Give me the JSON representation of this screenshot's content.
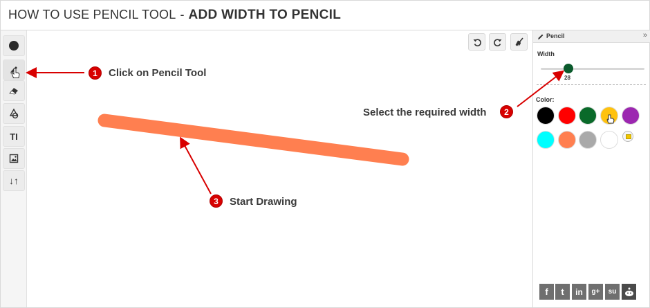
{
  "header": {
    "subtitle": "HOW TO USE PENCIL TOOL",
    "separator": "-",
    "title": "ADD WIDTH TO PENCIL"
  },
  "toolbar": {
    "tools": [
      {
        "name": "brush-size",
        "icon": "filled-circle-icon"
      },
      {
        "name": "pencil",
        "icon": "pencil-icon",
        "active": true
      },
      {
        "name": "eraser",
        "icon": "eraser-icon"
      },
      {
        "name": "shapes",
        "icon": "shapes-icon"
      },
      {
        "name": "text",
        "icon": "text-icon",
        "label": "TI"
      },
      {
        "name": "image",
        "icon": "image-icon"
      },
      {
        "name": "arrange",
        "icon": "sort-arrows-icon",
        "label": "↓↑"
      }
    ]
  },
  "canvas_actions": {
    "undo_icon": "undo-icon",
    "redo_icon": "redo-icon",
    "clear_icon": "broom-icon"
  },
  "canvas": {
    "stroke_color": "#ff7f50"
  },
  "panel": {
    "title": "Pencil",
    "expand_label": "»",
    "width_label": "Width",
    "width_value": "28",
    "color_label": "Color:",
    "colors": [
      "#000000",
      "#ff0000",
      "#0a6a2a",
      "#ffc20e",
      "#9c27b0",
      "#00ffff",
      "#ff7f50",
      "#a9a9a9",
      "#ffffff"
    ],
    "selected_color": "#ffc20e"
  },
  "social": [
    "f",
    "t",
    "in",
    "g+",
    "su",
    "reddit"
  ],
  "annotations": [
    {
      "number": "1",
      "text": "Click on Pencil Tool"
    },
    {
      "number": "2",
      "text": "Select the required width"
    },
    {
      "number": "3",
      "text": "Start Drawing"
    }
  ]
}
